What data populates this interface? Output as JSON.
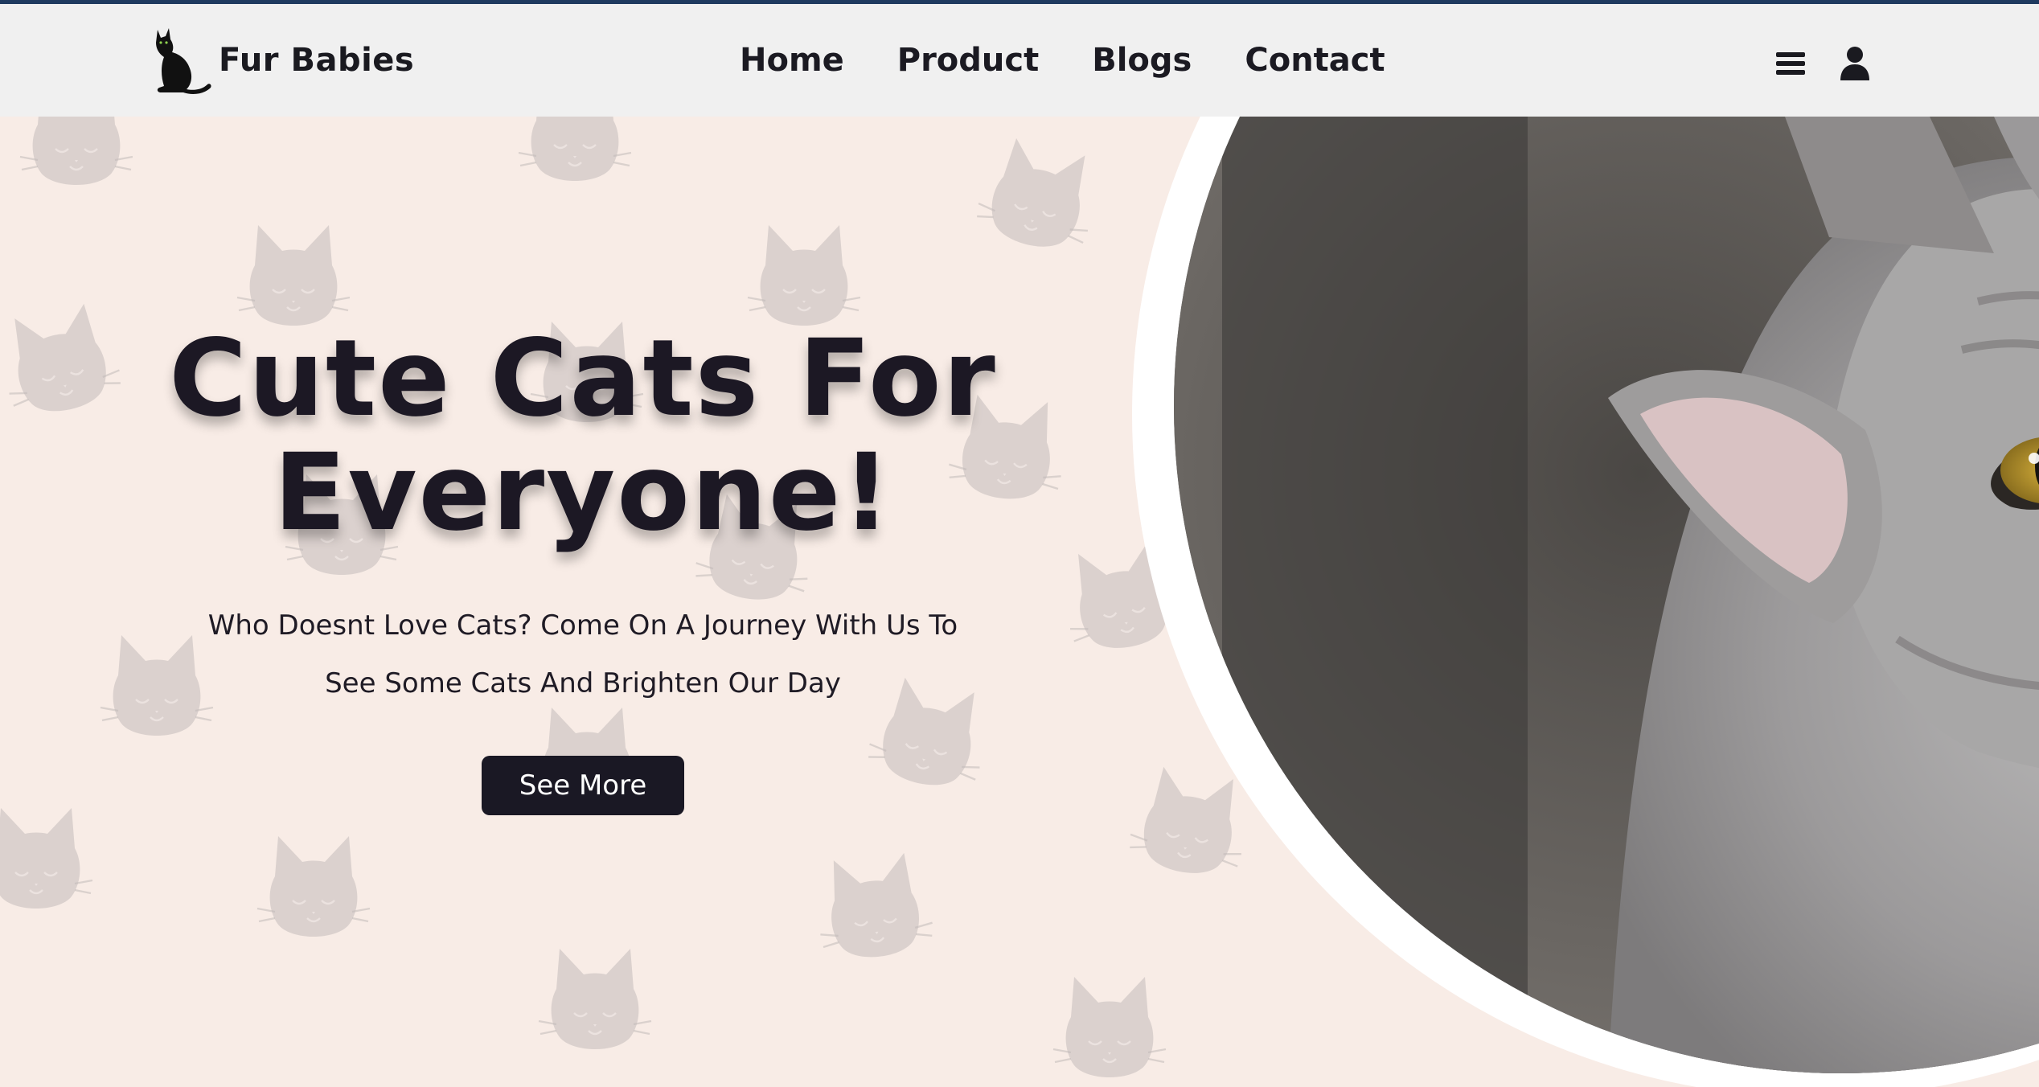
{
  "brand": {
    "name": "Fur Babies",
    "logo_icon": "black-cat-icon"
  },
  "nav": {
    "links": [
      "Home",
      "Product",
      "Blogs",
      "Contact"
    ],
    "menu_icon": "hamburger-menu-icon",
    "account_icon": "user-icon"
  },
  "hero": {
    "title_line1": "Cute Cats For",
    "title_line2": "Everyone!",
    "subtitle": "Who Doesnt Love Cats? Come On A Journey With Us To See Some Cats And Brighten Our Day",
    "cta_label": "See More",
    "background_pattern_icon": "cat-face-pattern-icon",
    "photo": "grey-tabby-cat-photo"
  },
  "colors": {
    "top_strip": "#1f3a5f",
    "navbar_bg": "#f0f0f0",
    "hero_bg": "#f8ece6",
    "text_dark": "#1c1824",
    "button_bg": "#1a1824",
    "button_text": "#ffffff",
    "ring": "#ffffff"
  }
}
